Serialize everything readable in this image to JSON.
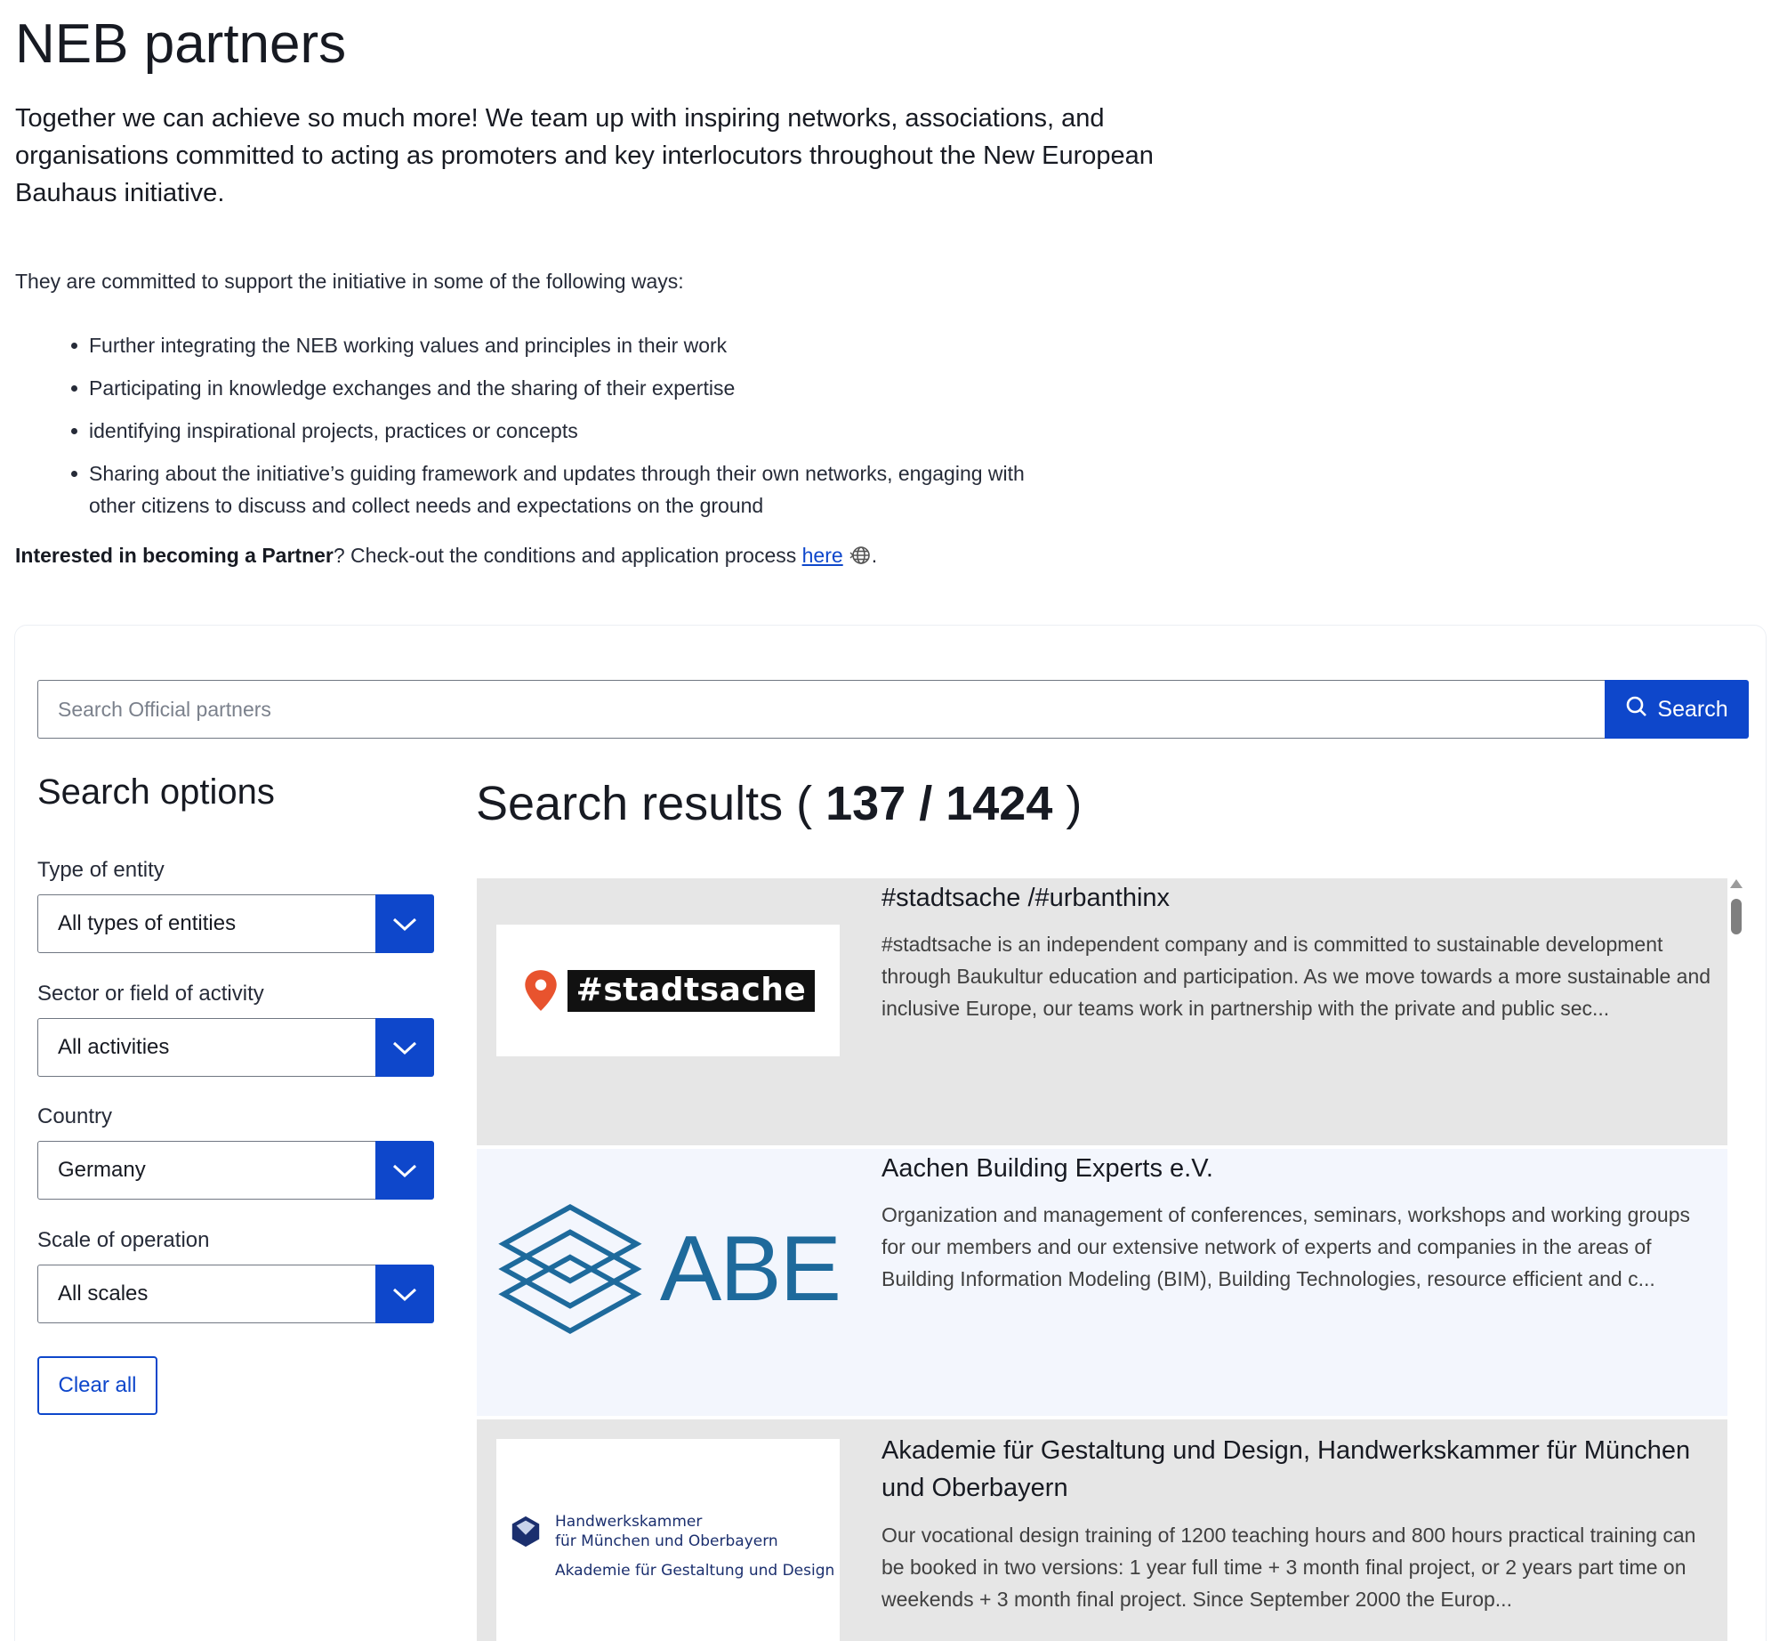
{
  "page": {
    "title": "NEB partners",
    "lead": "Together we can achieve so much more! We team up with inspiring networks, associations, and organisations committed to acting as promoters and key interlocutors throughout the New European Bauhaus initiative.",
    "intro": "They are committed to support the initiative in some of the following ways:",
    "ways": [
      "Further integrating the NEB working values and principles in their work",
      "Participating in knowledge exchanges and the sharing of their expertise",
      "identifying inspirational projects, practices or concepts",
      "Sharing about the initiative’s guiding framework and updates through their own networks, engaging with other citizens to discuss and collect needs and expectations on the ground"
    ],
    "cta": {
      "bold": "Interested in becoming a Partner",
      "text": "? Check-out the conditions and application process ",
      "link": "here",
      "end": "."
    }
  },
  "search": {
    "placeholder": "Search Official partners",
    "button_label": "Search"
  },
  "options": {
    "title": "Search options",
    "filters": [
      {
        "label": "Type of entity",
        "value": "All types of entities"
      },
      {
        "label": "Sector or field of activity",
        "value": "All activities"
      },
      {
        "label": "Country",
        "value": "Germany"
      },
      {
        "label": "Scale of operation",
        "value": "All scales"
      }
    ],
    "clear_label": "Clear all"
  },
  "results": {
    "title_prefix": "Search results ( ",
    "count": "137 / 1424",
    "title_suffix": " )",
    "items": [
      {
        "title": "#stadtsache /#urbanthinx",
        "description": "#stadtsache is an independent company and is committed to sustainable development through Baukultur education and participation. As we move towards a more sustainable and inclusive Europe, our teams work in partnership with the private and public sec...",
        "logo_text": "#stadtsache"
      },
      {
        "title": "Aachen Building Experts e.V.",
        "description": "Organization and management of conferences, seminars, workshops and working groups for our members and our extensive network of experts and companies in the areas of Building Information Modeling (BIM), Building Technologies, resource efficient and c...",
        "logo_text": "ABE"
      },
      {
        "title": "Akademie für Gestaltung und Design, Handwerkskammer für München und Oberbayern",
        "description": "Our vocational design training of 1200 teaching hours and 800 hours practical training can be booked in two versions: 1 year full time + 3 month final project, or 2 years part time on weekends + 3 month final project. Since September 2000 the Europ...",
        "logo_line1": "Handwerkskammer",
        "logo_line2": "für München und Oberbayern",
        "logo_line3": "Akademie für Gestaltung und Design"
      }
    ]
  },
  "colors": {
    "primary": "#0e47cb",
    "text": "#171a22",
    "result_gray": "#e6e6e6",
    "result_light": "#f3f6fd",
    "abe_blue": "#1e6a9c"
  }
}
